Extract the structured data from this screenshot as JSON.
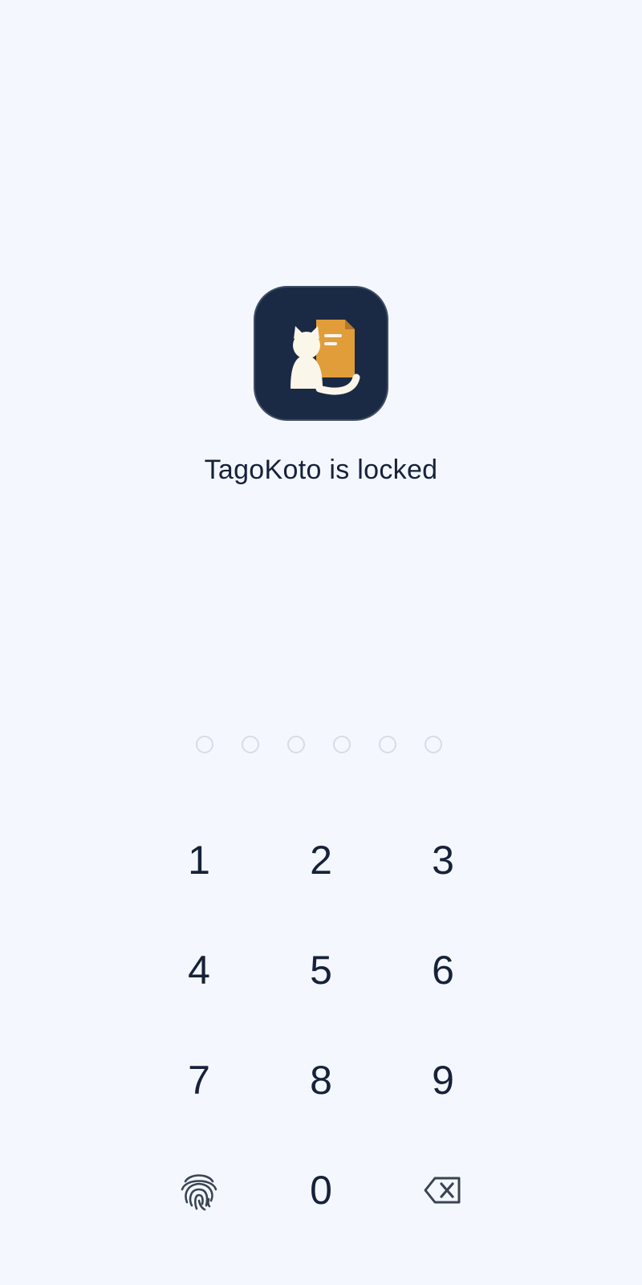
{
  "app": {
    "logo_icon": "tagokoto-cat-document-logo",
    "lock_message": "TagoKoto is locked"
  },
  "pin": {
    "length": 6,
    "entered": 0
  },
  "keypad": {
    "digits": [
      "1",
      "2",
      "3",
      "4",
      "5",
      "6",
      "7",
      "8",
      "9",
      "0"
    ],
    "biometric_icon": "fingerprint-icon",
    "backspace_icon": "backspace-icon"
  },
  "colors": {
    "background": "#f4f8fe",
    "icon_bg": "#1b2a44",
    "accent_orange": "#e09d3a",
    "cat": "#faf6ea",
    "text": "#17223a",
    "dot_outline": "#d6dce6"
  }
}
